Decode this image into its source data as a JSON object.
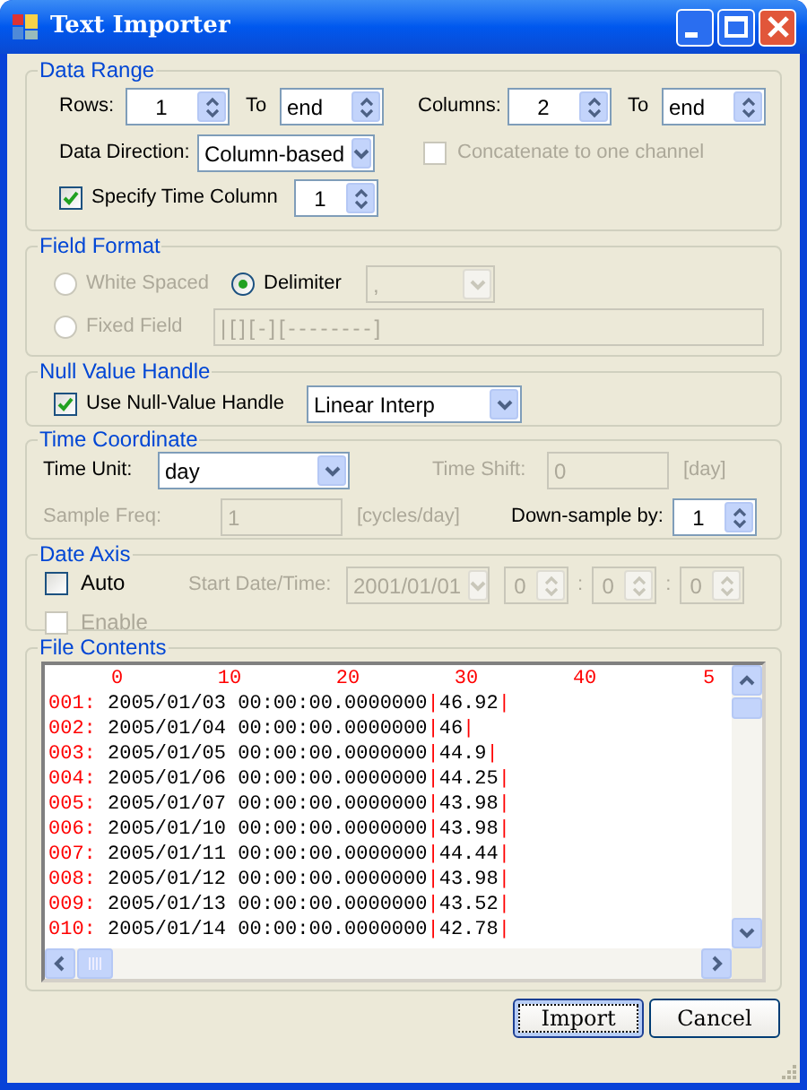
{
  "window": {
    "title": "Text Importer"
  },
  "data_range": {
    "title": "Data Range",
    "rows_label": "Rows:",
    "rows_from": "1",
    "rows_to_label": "To",
    "rows_to": "end",
    "columns_label": "Columns:",
    "columns_from": "2",
    "columns_to_label": "To",
    "columns_to": "end",
    "direction_label": "Data Direction:",
    "direction": "Column-based",
    "concatenate": {
      "label": "Concatenate to one channel",
      "checked": false,
      "disabled": true
    },
    "time_column": {
      "label": "Specify Time Column",
      "checked": true,
      "value": "1"
    }
  },
  "field_format": {
    "title": "Field Format",
    "options": [
      {
        "label": "White Spaced",
        "selected": false,
        "disabled": true
      },
      {
        "label": "Delimiter",
        "selected": true,
        "disabled": false
      },
      {
        "label": "Fixed Field",
        "selected": false,
        "disabled": true
      }
    ],
    "delimiter": {
      "value": ",",
      "disabled": true
    },
    "fixed_pattern": {
      "value": "|[][-][--------]",
      "disabled": true
    }
  },
  "null_value": {
    "title": "Null Value Handle",
    "use": {
      "label": "Use Null-Value Handle",
      "checked": true
    },
    "method": "Linear Interp"
  },
  "time_coordinate": {
    "title": "Time Coordinate",
    "unit_label": "Time Unit:",
    "unit": "day",
    "shift_label": "Time Shift:",
    "shift": "0",
    "shift_unit": "[day]",
    "shift_disabled": true,
    "freq_label": "Sample Freq:",
    "freq": "1",
    "freq_unit": "[cycles/day]",
    "freq_disabled": true,
    "downsample_label": "Down-sample by:",
    "downsample": "1"
  },
  "date_axis": {
    "title": "Date Axis",
    "auto": {
      "label": "Auto",
      "checked": false
    },
    "enable": {
      "label": "Enable",
      "checked": false,
      "disabled": true
    },
    "start_label": "Start Date/Time:",
    "start_date": "2001/01/01",
    "hour": "0",
    "minute": "0",
    "second": "0",
    "separators": [
      ":",
      ":"
    ],
    "disabled": true
  },
  "file_contents": {
    "title": "File Contents",
    "ruler": [
      "0",
      "10",
      "20",
      "30",
      "40",
      "5"
    ],
    "separator": "|",
    "rows": [
      {
        "number": "001:",
        "fields": [
          "2005/01/03 00:00:00.0000000",
          "46.92"
        ]
      },
      {
        "number": "002:",
        "fields": [
          "2005/01/04 00:00:00.0000000",
          "46"
        ]
      },
      {
        "number": "003:",
        "fields": [
          "2005/01/05 00:00:00.0000000",
          "44.9"
        ]
      },
      {
        "number": "004:",
        "fields": [
          "2005/01/06 00:00:00.0000000",
          "44.25"
        ]
      },
      {
        "number": "005:",
        "fields": [
          "2005/01/07 00:00:00.0000000",
          "43.98"
        ]
      },
      {
        "number": "006:",
        "fields": [
          "2005/01/10 00:00:00.0000000",
          "43.98"
        ]
      },
      {
        "number": "007:",
        "fields": [
          "2005/01/11 00:00:00.0000000",
          "44.44"
        ]
      },
      {
        "number": "008:",
        "fields": [
          "2005/01/12 00:00:00.0000000",
          "43.98"
        ]
      },
      {
        "number": "009:",
        "fields": [
          "2005/01/13 00:00:00.0000000",
          "43.52"
        ]
      },
      {
        "number": "010:",
        "fields": [
          "2005/01/14 00:00:00.0000000",
          "42.78"
        ]
      }
    ]
  },
  "buttons": [
    {
      "label": "Import",
      "default": true
    },
    {
      "label": "Cancel",
      "default": false
    }
  ]
}
